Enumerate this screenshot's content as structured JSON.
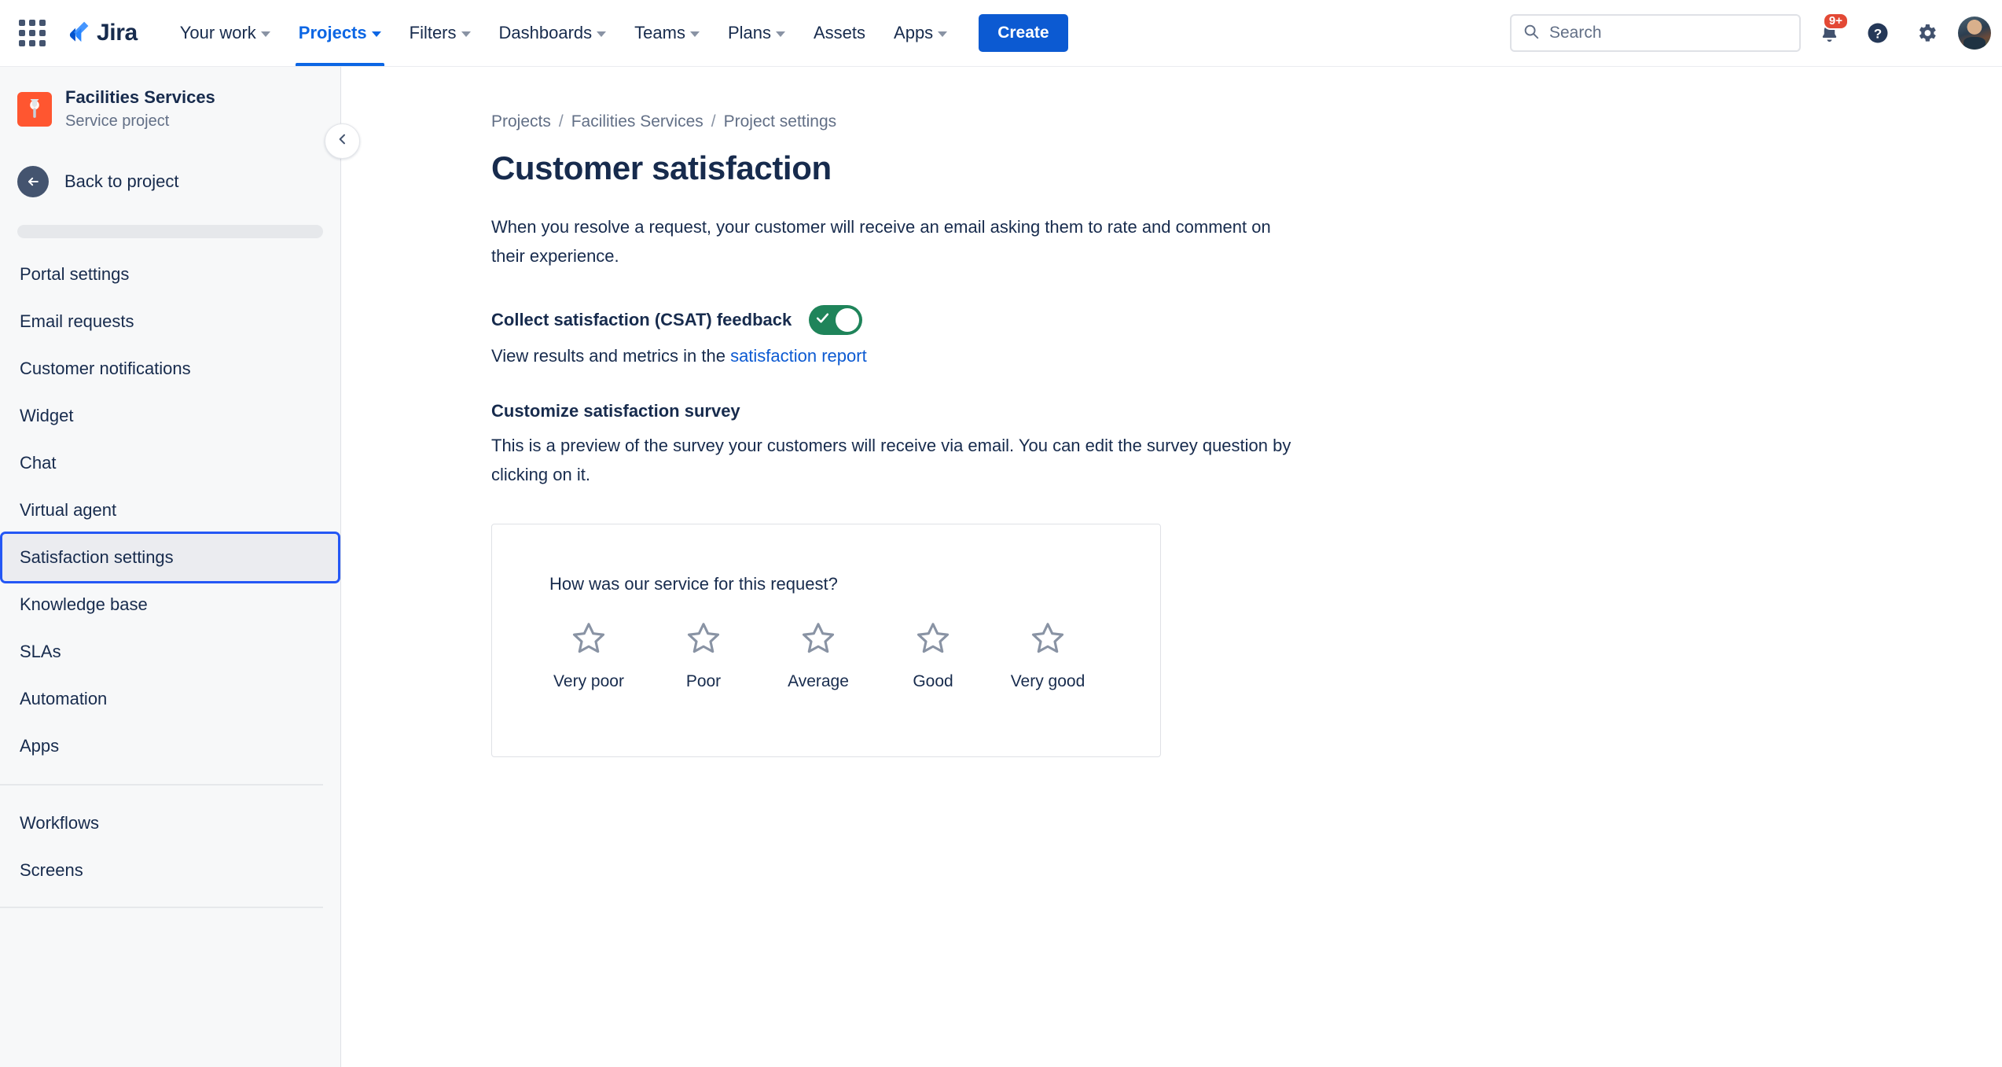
{
  "topnav": {
    "app_switcher_icon": "grid-apps-icon",
    "logo_text": "Jira",
    "items": [
      {
        "label": "Your work",
        "has_chevron": true,
        "active": false
      },
      {
        "label": "Projects",
        "has_chevron": true,
        "active": true
      },
      {
        "label": "Filters",
        "has_chevron": true,
        "active": false
      },
      {
        "label": "Dashboards",
        "has_chevron": true,
        "active": false
      },
      {
        "label": "Teams",
        "has_chevron": true,
        "active": false
      },
      {
        "label": "Plans",
        "has_chevron": true,
        "active": false
      },
      {
        "label": "Assets",
        "has_chevron": false,
        "active": false
      },
      {
        "label": "Apps",
        "has_chevron": true,
        "active": false
      }
    ],
    "create_label": "Create",
    "search_placeholder": "Search",
    "notification_badge": "9+",
    "icons": [
      "notifications-bell-icon",
      "help-question-icon",
      "settings-gear-icon",
      "user-avatar"
    ],
    "accent_color": "#0c66e4",
    "create_button_color": "#0c5ad2",
    "badge_color": "#e34935"
  },
  "sidebar": {
    "project_name": "Facilities Services",
    "project_type": "Service project",
    "project_icon_color": "#ff5630",
    "back_label": "Back to project",
    "items": [
      {
        "label": "Portal settings",
        "selected": false
      },
      {
        "label": "Email requests",
        "selected": false
      },
      {
        "label": "Customer notifications",
        "selected": false
      },
      {
        "label": "Widget",
        "selected": false
      },
      {
        "label": "Chat",
        "selected": false
      },
      {
        "label": "Virtual agent",
        "selected": false
      },
      {
        "label": "Satisfaction settings",
        "selected": true
      },
      {
        "label": "Knowledge base",
        "selected": false
      },
      {
        "label": "SLAs",
        "selected": false
      },
      {
        "label": "Automation",
        "selected": false
      },
      {
        "label": "Apps",
        "selected": false
      }
    ],
    "items_after_divider": [
      {
        "label": "Workflows",
        "selected": false
      },
      {
        "label": "Screens",
        "selected": false
      }
    ],
    "selected_outline_color": "#2457f5"
  },
  "main": {
    "breadcrumbs": [
      "Projects",
      "Facilities Services",
      "Project settings"
    ],
    "breadcrumb_separator": "/",
    "title": "Customer satisfaction",
    "description": "When you resolve a request, your customer will receive an email asking them to rate and comment on their experience.",
    "csat": {
      "label": "Collect satisfaction (CSAT) feedback",
      "enabled": true,
      "toggle_color": "#1f845a",
      "sub_prefix": "View results and metrics in the ",
      "sub_link": "satisfaction report"
    },
    "customize": {
      "heading": "Customize satisfaction survey",
      "paragraph": "This is a preview of the survey your customers will receive via email. You can edit the survey question by clicking on it."
    },
    "survey": {
      "question": "How was our service for this request?",
      "ratings": [
        {
          "label": "Very poor",
          "value": 1,
          "filled": false
        },
        {
          "label": "Poor",
          "value": 2,
          "filled": false
        },
        {
          "label": "Average",
          "value": 3,
          "filled": false
        },
        {
          "label": "Good",
          "value": 4,
          "filled": false
        },
        {
          "label": "Very good",
          "value": 5,
          "filled": false
        }
      ],
      "star_color": "#8993a4"
    }
  }
}
